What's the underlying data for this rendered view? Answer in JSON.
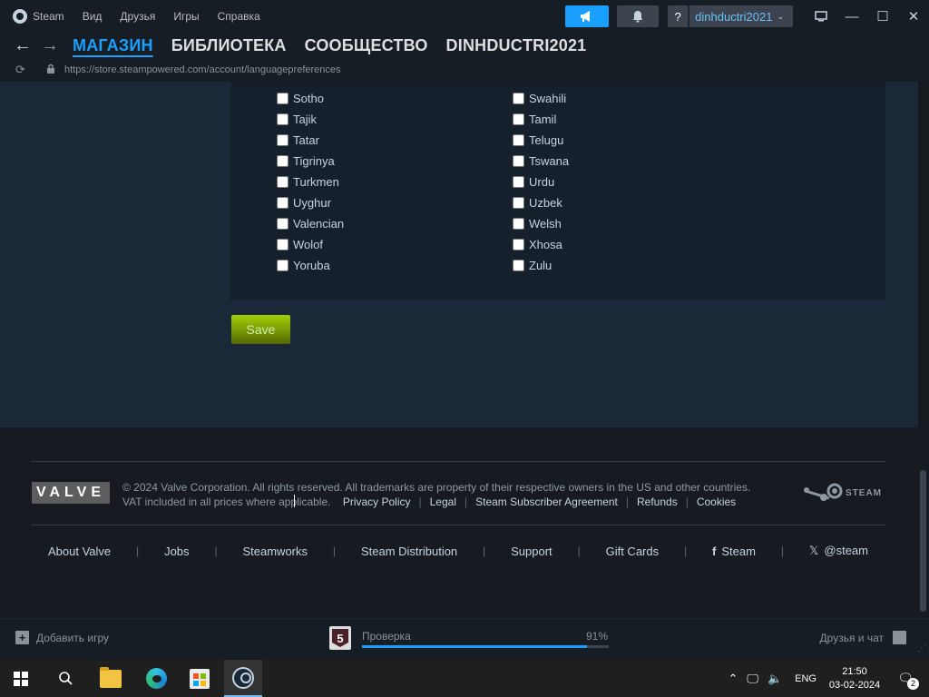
{
  "titlebar": {
    "menu": [
      "Steam",
      "Вид",
      "Друзья",
      "Игры",
      "Справка"
    ],
    "help_label": "?",
    "account_name": "dinhductri2021"
  },
  "nav": {
    "tabs": [
      "МАГАЗИН",
      "БИБЛИОТЕКА",
      "СООБЩЕСТВО",
      "DINHDUCTRI2021"
    ],
    "active_tab": "МАГАЗИН"
  },
  "url": "https://store.steampowered.com/account/languagepreferences",
  "languages": {
    "column1": [
      "Sotho",
      "Tajik",
      "Tatar",
      "Tigrinya",
      "Turkmen",
      "Uyghur",
      "Valencian",
      "Wolof",
      "Yoruba"
    ],
    "column2": [
      "Swahili",
      "Tamil",
      "Telugu",
      "Tswana",
      "Urdu",
      "Uzbek",
      "Welsh",
      "Xhosa",
      "Zulu"
    ]
  },
  "save_label": "Save",
  "footer": {
    "valve_logo": "VALVE",
    "copyright": "© 2024 Valve Corporation. All rights reserved. All trademarks are property of their respective owners in the US and other countries.",
    "vat_note": "VAT included in all prices where applicable.",
    "legal_links": [
      "Privacy Policy",
      "Legal",
      "Steam Subscriber Agreement",
      "Refunds",
      "Cookies"
    ],
    "steam_logo_text": "STEAM",
    "links": [
      "About Valve",
      "Jobs",
      "Steamworks",
      "Steam Distribution",
      "Support",
      "Gift Cards",
      "Steam",
      "@steam"
    ]
  },
  "statusbar": {
    "add_game": "Добавить игру",
    "download_badge": "5",
    "download_label": "Проверка",
    "download_percent": "91%",
    "download_progress": 0.91,
    "friends_chat": "Друзья и чат"
  },
  "taskbar": {
    "language": "ENG",
    "time": "21:50",
    "date": "03-02-2024",
    "notifications": "2"
  },
  "colors": {
    "accent": "#1a9fff",
    "save_green": "#a4d007",
    "background": "#1b2838"
  }
}
